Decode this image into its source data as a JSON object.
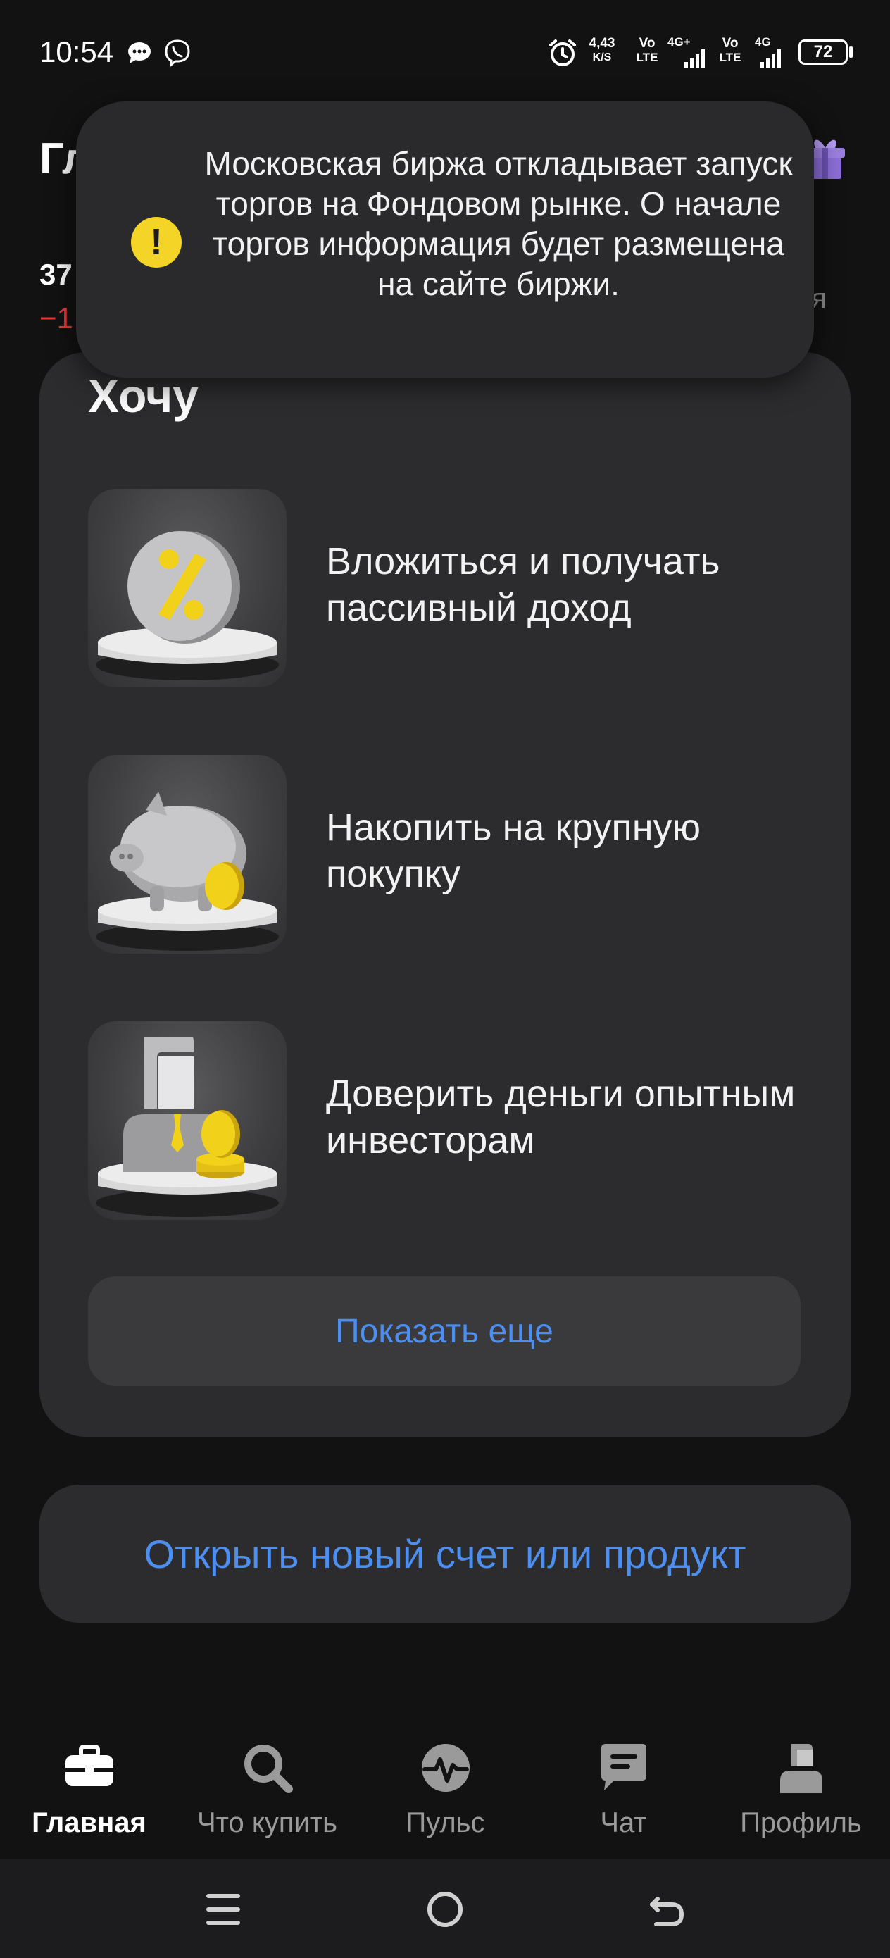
{
  "status_bar": {
    "time": "10:54",
    "net_speed": "4,43",
    "net_unit": "K/S",
    "sim1_vo": "Vo",
    "sim1_lte": "LTE",
    "sim1_gen": "4G+",
    "sim2_vo": "Vo",
    "sim2_lte": "LTE",
    "sim2_gen": "4G",
    "battery": "72",
    "icons": [
      "chat-bubble-icon",
      "viber-icon",
      "alarm-icon",
      "signal-icon",
      "battery-icon"
    ]
  },
  "header": {
    "title_partial": "Гл",
    "balance_partial": "37",
    "change_partial": "−1",
    "period_partial": "ня",
    "gift_icon": "gift-icon"
  },
  "toast": {
    "icon": "warning-icon",
    "message": "Московская биржа откладывает запуск торгов на Фондовом рынке. О начале торгов информация будет размещена на сайте биржи."
  },
  "want_section": {
    "title": "Хочу",
    "items": [
      {
        "label": "Вложиться и получать пассивный доход",
        "icon": "percent-icon"
      },
      {
        "label": "Накопить на крупную покупку",
        "icon": "piggy-bank-icon"
      },
      {
        "label": "Доверить деньги опытным инвесторам",
        "icon": "investor-icon"
      }
    ],
    "show_more": "Показать еще"
  },
  "open_account": "Открыть новый счет или продукт",
  "bottom_nav": [
    {
      "label": "Главная",
      "icon": "briefcase-icon",
      "active": true
    },
    {
      "label": "Что купить",
      "icon": "search-icon",
      "active": false
    },
    {
      "label": "Пульс",
      "icon": "pulse-icon",
      "active": false
    },
    {
      "label": "Чат",
      "icon": "chat-icon",
      "active": false
    },
    {
      "label": "Профиль",
      "icon": "profile-icon",
      "active": false
    }
  ],
  "colors": {
    "background": "#121212",
    "card": "#2c2c2e",
    "accent_link": "#4d8ff0",
    "negative": "#e63a3a",
    "warning": "#f5d428",
    "gift": "#9b7fe0"
  }
}
